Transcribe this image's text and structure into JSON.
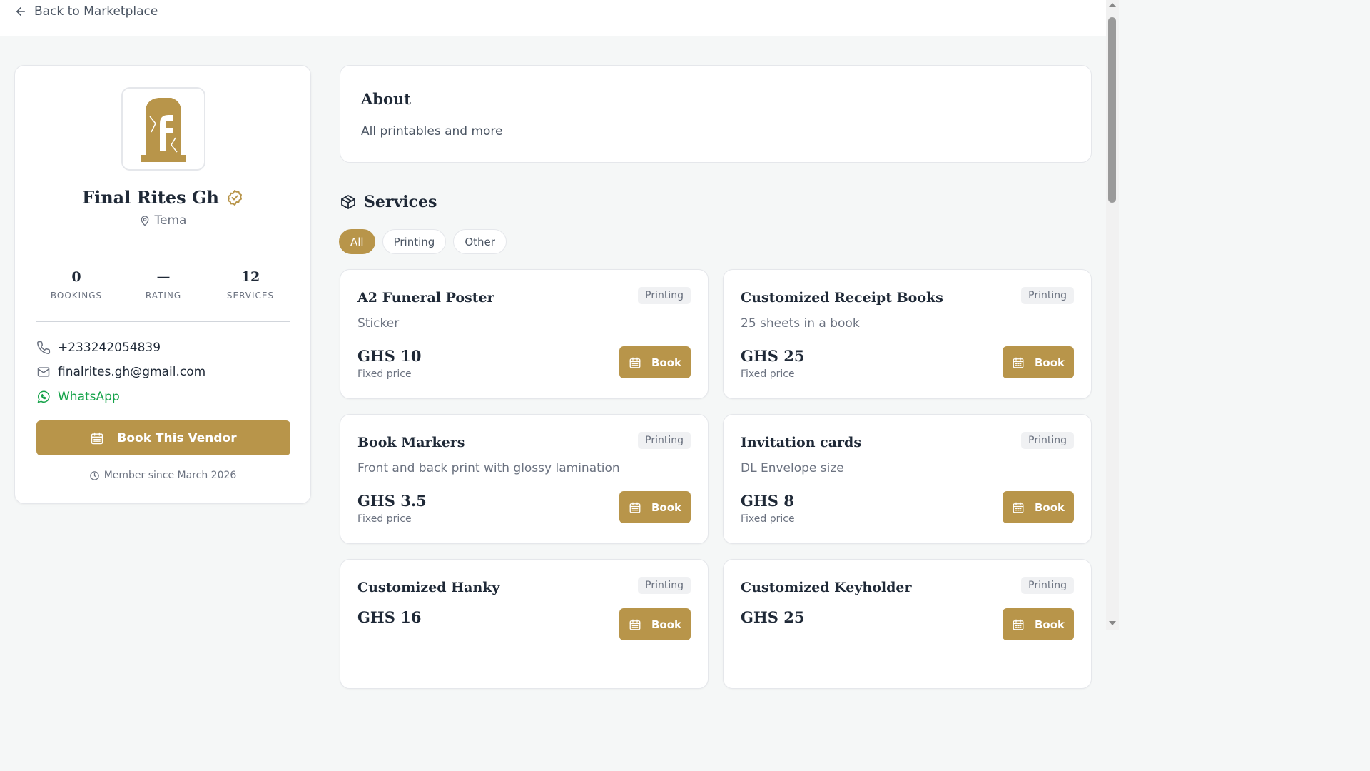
{
  "nav": {
    "back_label": "Back to Marketplace"
  },
  "colors": {
    "accent": "#b8954a",
    "whatsapp": "#16a34a"
  },
  "vendor": {
    "name": "Final Rites Gh",
    "location": "Tema",
    "verified": true,
    "stats": [
      {
        "value": "0",
        "label": "BOOKINGS"
      },
      {
        "value": "—",
        "label": "RATING"
      },
      {
        "value": "12",
        "label": "SERVICES"
      }
    ],
    "phone": "+233242054839",
    "email": "finalrites.gh@gmail.com",
    "whatsapp_label": "WhatsApp",
    "book_label": "Book This Vendor",
    "member_since": "Member since March 2026"
  },
  "about": {
    "title": "About",
    "text": "All printables and more"
  },
  "services": {
    "title": "Services",
    "filters": [
      "All",
      "Printing",
      "Other"
    ],
    "active_filter": "All",
    "items": [
      {
        "title": "A2 Funeral Poster",
        "tag": "Printing",
        "description": "Sticker",
        "price": "GHS 10",
        "price_type": "Fixed price",
        "book_label": "Book"
      },
      {
        "title": "Customized Receipt Books",
        "tag": "Printing",
        "description": "25 sheets in a book",
        "price": "GHS 25",
        "price_type": "Fixed price",
        "book_label": "Book"
      },
      {
        "title": "Book Markers",
        "tag": "Printing",
        "description": "Front and back print with glossy lamination",
        "price": "GHS 3.5",
        "price_type": "Fixed price",
        "book_label": "Book"
      },
      {
        "title": "Invitation cards",
        "tag": "Printing",
        "description": "DL Envelope size",
        "price": "GHS 8",
        "price_type": "Fixed price",
        "book_label": "Book"
      },
      {
        "title": "Customized Hanky",
        "tag": "Printing",
        "description": "",
        "price": "GHS 16",
        "price_type": "",
        "book_label": "Book"
      },
      {
        "title": "Customized Keyholder",
        "tag": "Printing",
        "description": "",
        "price": "GHS 25",
        "price_type": "",
        "book_label": "Book"
      }
    ]
  }
}
